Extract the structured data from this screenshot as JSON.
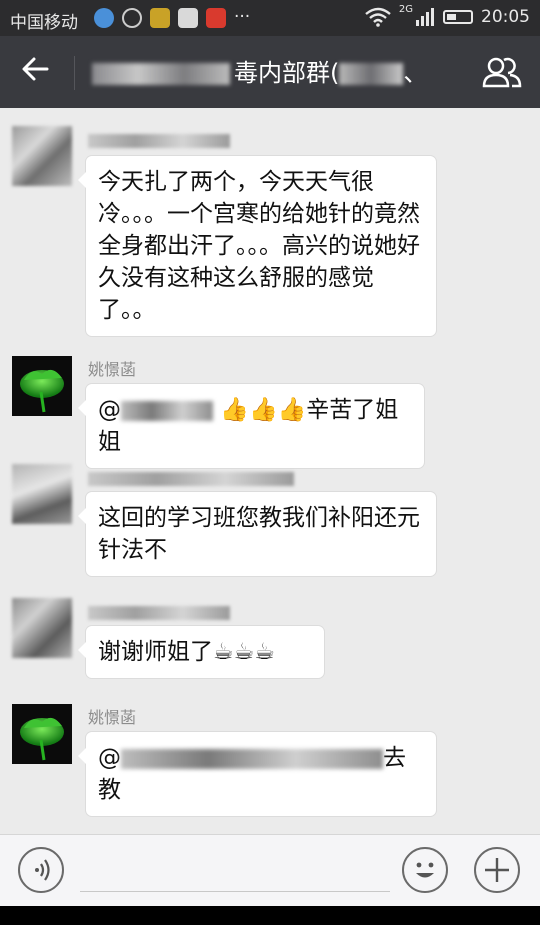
{
  "status_bar": {
    "carrier": "中国移动",
    "more": "···",
    "net": "2G",
    "time": "20:05",
    "battery_fraction": 0.4
  },
  "header": {
    "title_visible": "毒内部群(",
    "title_tail": "、"
  },
  "messages": [
    {
      "text": "今天扎了两个，今天天气很冷。。。一个宫寒的给她针的竟然全身都出汗了。。。高兴的说她好久没有这种这么舒服的感觉了。。"
    },
    {
      "sender": "姚憬菡",
      "prefix": "@",
      "text": "👍👍👍辛苦了姐姐"
    },
    {
      "text": "这回的学习班您教我们补阳还元针法不"
    },
    {
      "text": "谢谢师姐了☕☕☕"
    },
    {
      "sender": "姚憬菡",
      "prefix": "@",
      "line1_tail": "去",
      "line2": "教"
    }
  ],
  "colors": {
    "status_bar": "#2c2c2e",
    "title_bar": "#393a3f",
    "chat_background": "#ebebeb",
    "bubble": "#ffffff"
  },
  "icons": [
    "back-arrow-icon",
    "group-members-icon",
    "voice-icon",
    "emoji-icon",
    "plus-icon",
    "wifi-icon",
    "signal-icon",
    "battery-icon"
  ]
}
